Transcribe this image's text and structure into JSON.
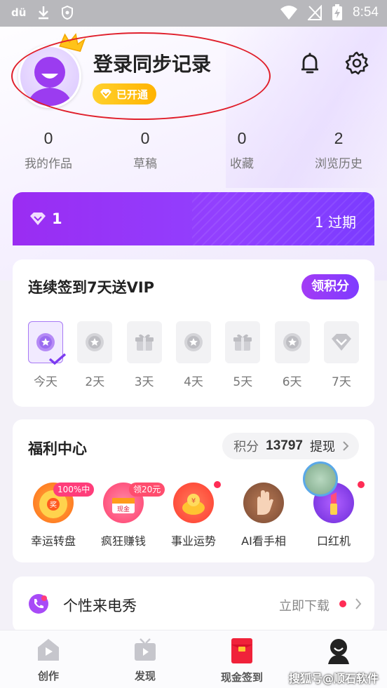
{
  "status_bar": {
    "app_glyph": "dü",
    "time": "8:54"
  },
  "profile": {
    "title": "登录同步记录",
    "badge": "已开通",
    "stats": [
      {
        "value": "0",
        "label": "我的作品"
      },
      {
        "value": "0",
        "label": "草稿"
      },
      {
        "value": "0",
        "label": "收藏"
      },
      {
        "value": "2",
        "label": "浏览历史"
      }
    ]
  },
  "vip_bar": {
    "count": "1",
    "expired": "1 过期"
  },
  "checkin": {
    "title": "连续签到7天送VIP",
    "button": "领积分",
    "days": [
      {
        "label": "今天",
        "icon": "star-coin-icon"
      },
      {
        "label": "2天",
        "icon": "star-coin-icon"
      },
      {
        "label": "3天",
        "icon": "gift-icon"
      },
      {
        "label": "4天",
        "icon": "star-coin-icon"
      },
      {
        "label": "5天",
        "icon": "gift-icon"
      },
      {
        "label": "6天",
        "icon": "star-coin-icon"
      },
      {
        "label": "7天",
        "icon": "diamond-icon"
      }
    ]
  },
  "welfare": {
    "title": "福利中心",
    "points_label": "积分",
    "points_value": "13797",
    "withdraw": "提现",
    "items": [
      {
        "label": "幸运转盘",
        "tag": "100%中"
      },
      {
        "label": "疯狂赚钱",
        "tag": "领20元"
      },
      {
        "label": "事业运势",
        "tag": ""
      },
      {
        "label": "AI看手相",
        "tag": ""
      },
      {
        "label": "口红机",
        "tag": ""
      }
    ]
  },
  "ringtone": {
    "title": "个性来电秀",
    "action": "立即下载"
  },
  "nav": [
    {
      "label": "创作"
    },
    {
      "label": "发现"
    },
    {
      "label": "现金签到"
    },
    {
      "label": ""
    }
  ],
  "watermark": "搜狐号@顺石软件",
  "colors": {
    "accent": "#9141ff",
    "badge": "#ffb300",
    "annotation": "#e01f2b"
  }
}
